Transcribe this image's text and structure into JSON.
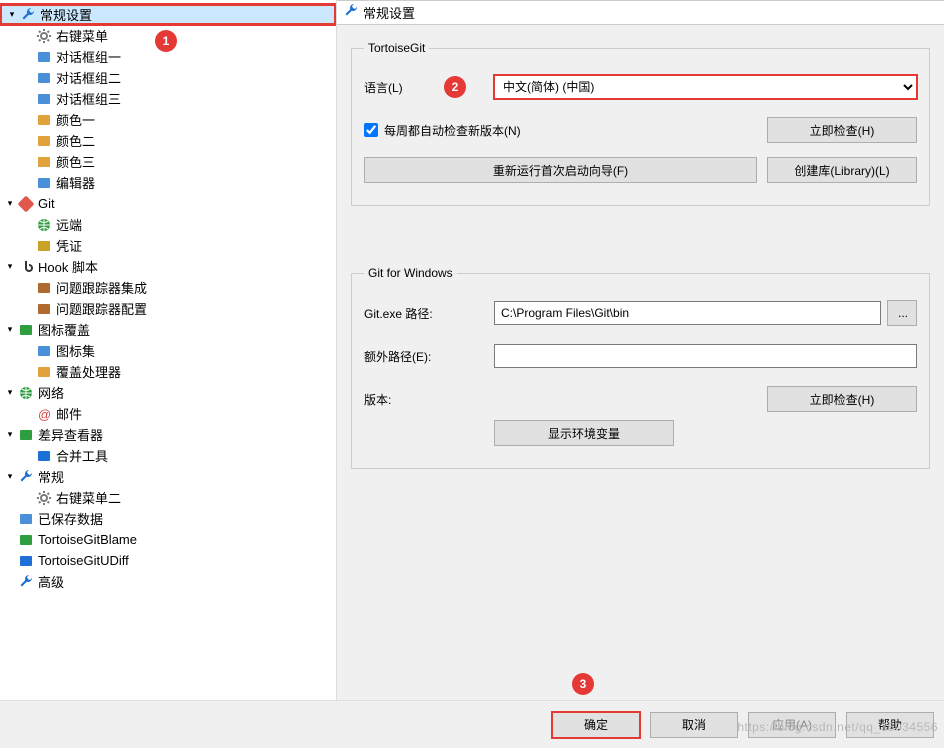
{
  "header": {
    "title": "常规设置"
  },
  "tree": [
    {
      "label": "常规设置",
      "icon": "wrench",
      "level": 0,
      "expandable": true,
      "selected": true
    },
    {
      "label": "右键菜单",
      "icon": "gear",
      "level": 1
    },
    {
      "label": "对话框组一",
      "icon": "dialog",
      "level": 1
    },
    {
      "label": "对话框组二",
      "icon": "dialog",
      "level": 1
    },
    {
      "label": "对话框组三",
      "icon": "dialog",
      "level": 1
    },
    {
      "label": "颜色一",
      "icon": "color",
      "level": 1
    },
    {
      "label": "颜色二",
      "icon": "color",
      "level": 1
    },
    {
      "label": "颜色三",
      "icon": "color",
      "level": 1
    },
    {
      "label": "编辑器",
      "icon": "editor",
      "level": 1
    },
    {
      "label": "Git",
      "icon": "git",
      "level": 0,
      "expandable": true
    },
    {
      "label": "远端",
      "icon": "globe",
      "level": 1
    },
    {
      "label": "凭证",
      "icon": "key",
      "level": 1
    },
    {
      "label": "Hook 脚本",
      "icon": "hook",
      "level": 0,
      "expandable": true
    },
    {
      "label": "问题跟踪器集成",
      "icon": "bug",
      "level": 1
    },
    {
      "label": "问题跟踪器配置",
      "icon": "bug",
      "level": 1
    },
    {
      "label": "图标覆盖",
      "icon": "overlay",
      "level": 0,
      "expandable": true
    },
    {
      "label": "图标集",
      "icon": "iconset",
      "level": 1
    },
    {
      "label": "覆盖处理器",
      "icon": "handler",
      "level": 1
    },
    {
      "label": "网络",
      "icon": "globe",
      "level": 0,
      "expandable": true
    },
    {
      "label": "邮件",
      "icon": "mail",
      "level": 1
    },
    {
      "label": "差异查看器",
      "icon": "diff",
      "level": 0,
      "expandable": true
    },
    {
      "label": "合并工具",
      "icon": "merge",
      "level": 1
    },
    {
      "label": "常规",
      "icon": "wrench",
      "level": 0,
      "expandable": true
    },
    {
      "label": "右键菜单二",
      "icon": "gear",
      "level": 1
    },
    {
      "label": "已保存数据",
      "icon": "disk",
      "level": 0
    },
    {
      "label": "TortoiseGitBlame",
      "icon": "blame",
      "level": 0
    },
    {
      "label": "TortoiseGitUDiff",
      "icon": "udiff",
      "level": 0
    },
    {
      "label": "高级",
      "icon": "wrench",
      "level": 0
    }
  ],
  "tortoiseGit": {
    "legend": "TortoiseGit",
    "languageLabel": "语言(L)",
    "languageValue": "中文(简体) (中国)",
    "weeklyCheckLabel": "每周都自动检查新版本(N)",
    "weeklyCheckChecked": true,
    "checkNowBtn": "立即检查(H)",
    "rerunWizardBtn": "重新运行首次启动向导(F)",
    "createLibraryBtn": "创建库(Library)(L)"
  },
  "gitForWindows": {
    "legend": "Git for Windows",
    "gitExePathLabel": "Git.exe 路径:",
    "gitExePathValue": "C:\\Program Files\\Git\\bin",
    "browseBtn": "...",
    "extraPathLabel": "额外路径(E):",
    "extraPathValue": "",
    "versionLabel": "版本:",
    "checkNowBtn": "立即检查(H)",
    "showEnvBtn": "显示环境变量"
  },
  "buttons": {
    "ok": "确定",
    "cancel": "取消",
    "apply": "应用(A)",
    "help": "帮助"
  },
  "annotations": {
    "b1": "1",
    "b2": "2",
    "b3": "3"
  },
  "watermark": "https://blog.csdn.net/qq_35034556"
}
